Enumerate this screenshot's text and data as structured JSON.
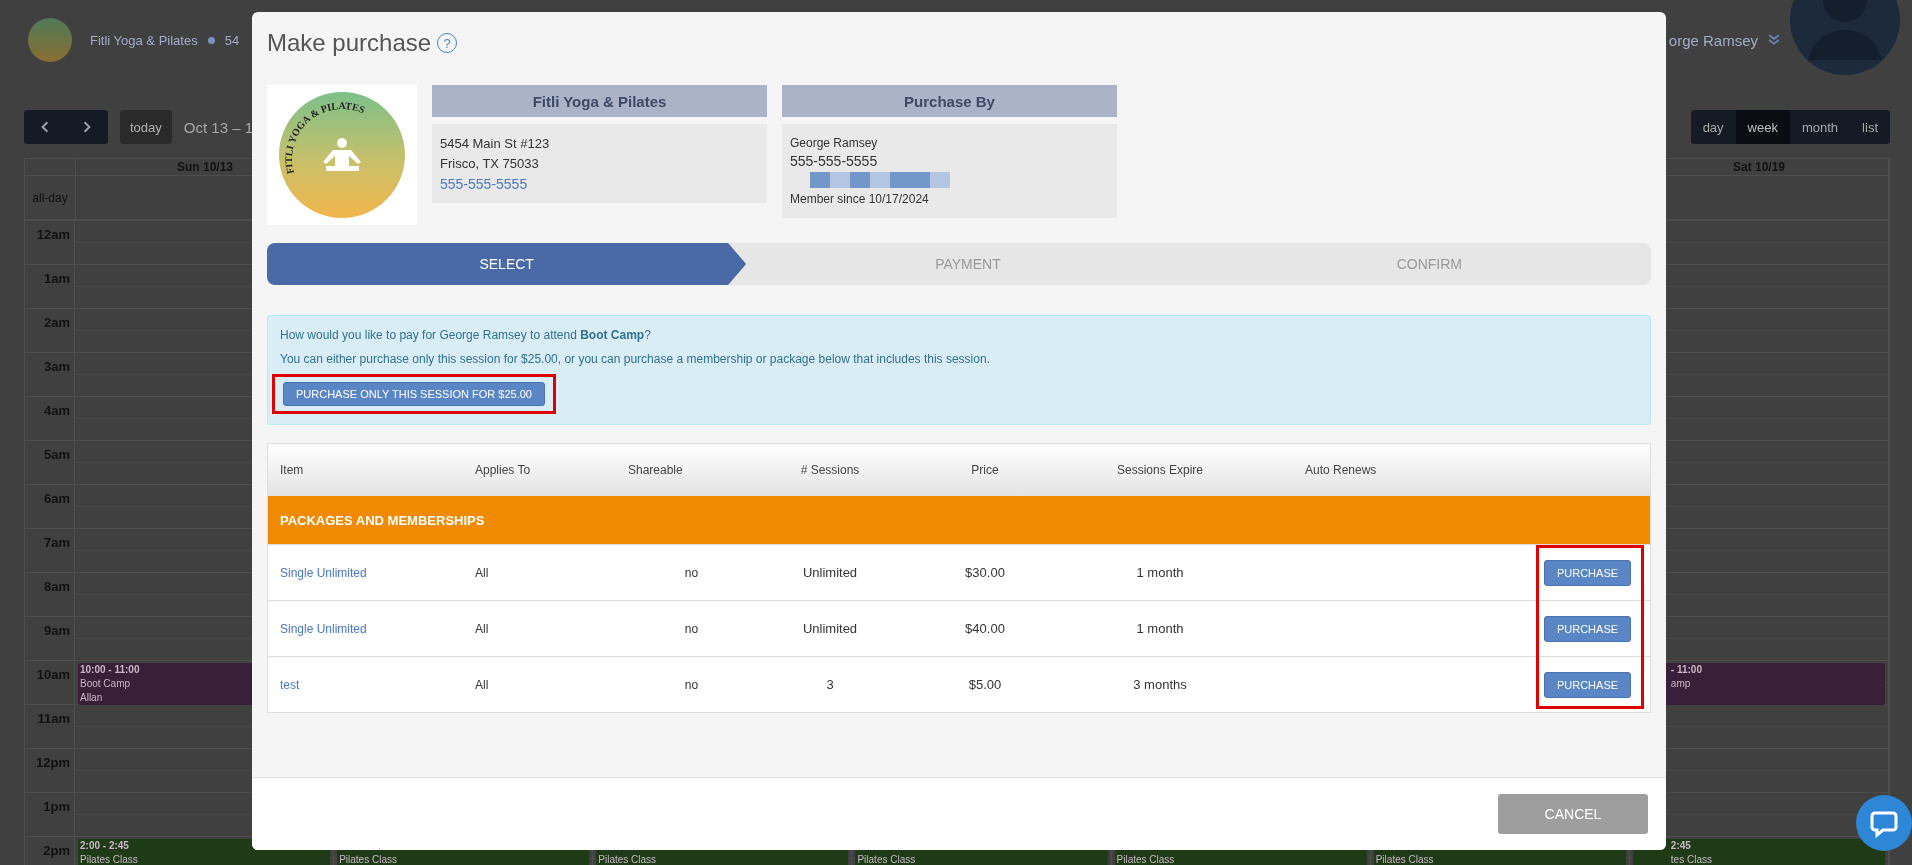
{
  "background": {
    "brand": "Fitli Yoga & Pilates",
    "address": "54",
    "user": "orge Ramsey",
    "today": "today",
    "date_range": "Oct 13 – 1",
    "views": [
      {
        "label": "day",
        "selected": false
      },
      {
        "label": "week",
        "selected": true
      },
      {
        "label": "month",
        "selected": false
      },
      {
        "label": "list",
        "selected": false
      }
    ],
    "all_day": "all-day",
    "hours": [
      "12am",
      "1am",
      "2am",
      "3am",
      "4am",
      "5am",
      "6am",
      "7am",
      "8am",
      "9am",
      "10am",
      "11am",
      "12pm",
      "1pm",
      "2pm"
    ],
    "columns": [
      {
        "header": "Sun 10/13",
        "events": [
          {
            "kind": "morning",
            "color": "#3a1f38",
            "lines": [
              "10:00 - 11:00",
              "Boot Camp",
              "Allan"
            ]
          },
          {
            "kind": "afternoon",
            "color": "#1f3a17",
            "lines": [
              "2:00 - 2:45",
              "Pilates Class"
            ]
          }
        ]
      },
      {
        "events": [
          {
            "kind": "afternoon",
            "color": "#1f3a17",
            "lines": [
              "Pilates Class"
            ]
          }
        ]
      },
      {
        "events": [
          {
            "kind": "afternoon",
            "color": "#1f3a17",
            "lines": [
              "Pilates Class"
            ]
          }
        ]
      },
      {
        "events": [
          {
            "kind": "afternoon",
            "color": "#1f3a17",
            "lines": [
              "Pilates Class"
            ]
          }
        ]
      },
      {
        "events": [
          {
            "kind": "afternoon",
            "color": "#1f3a17",
            "lines": [
              "Pilates Class"
            ]
          }
        ]
      },
      {
        "events": [
          {
            "kind": "afternoon",
            "color": "#1f3a17",
            "lines": [
              "Pilates Class"
            ]
          }
        ]
      },
      {
        "header": "Sat 10/19",
        "events": [
          {
            "kind": "morning",
            "color": "#3a1f38",
            "lines": [
              "- 11:00",
              "amp"
            ]
          },
          {
            "kind": "afternoon",
            "color": "#1f3a17",
            "lines": [
              "2:45",
              "tes Class"
            ]
          }
        ]
      }
    ]
  },
  "modal": {
    "title": "Make purchase",
    "help": "?",
    "logo_text": "FITLI YOGA & PILATES",
    "business": {
      "heading": "Fitli Yoga & Pilates",
      "address": [
        "5454 Main St #123",
        "Frisco, TX 75033"
      ],
      "phone": "555-555-5555"
    },
    "purchaser": {
      "heading": "Purchase By",
      "name": "George Ramsey",
      "phone": "555-555-5555",
      "member_since": "Member since 10/17/2024"
    },
    "steps": [
      {
        "label": "SELECT",
        "selected": true
      },
      {
        "label": "PAYMENT",
        "selected": false
      },
      {
        "label": "CONFIRM",
        "selected": false
      }
    ],
    "notice": {
      "question": "How would you like to pay for George Ramsey to attend **Boot Camp**?",
      "detail": "You can either purchase only this session for $25.00, or you can purchase a membership or package below that includes this session.",
      "button": "PURCHASE ONLY THIS SESSION FOR $25.00",
      "highlighted": true
    },
    "table": {
      "columns": [
        "Item",
        "Applies To",
        "Shareable",
        "# Sessions",
        "Price",
        "Sessions Expire",
        "Auto Renews"
      ],
      "group": "PACKAGES AND MEMBERSHIPS",
      "rows": [
        {
          "item": "Single Unlimited",
          "applies_to": "All",
          "shareable": "no",
          "sessions": "Unlimited",
          "price": "$30.00",
          "expire": "1 month",
          "action": "PURCHASE"
        },
        {
          "item": "Single Unlimited",
          "applies_to": "All",
          "shareable": "no",
          "sessions": "Unlimited",
          "price": "$40.00",
          "expire": "1 month",
          "action": "PURCHASE"
        },
        {
          "item": "test",
          "applies_to": "All",
          "shareable": "no",
          "sessions": "3",
          "price": "$5.00",
          "expire": "3 months",
          "action": "PURCHASE"
        }
      ],
      "actions_highlighted": true
    },
    "cancel": "CANCEL"
  }
}
